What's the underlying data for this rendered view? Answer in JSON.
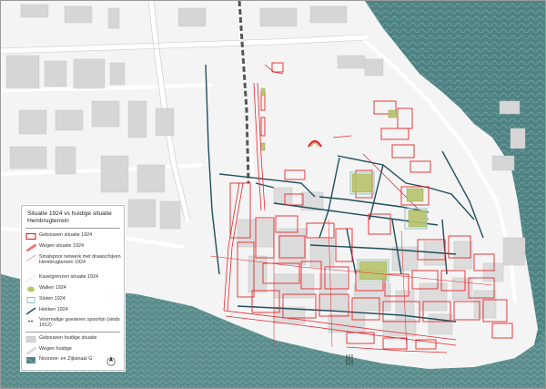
{
  "legend": {
    "title": "Situatie 1924 vs huidige situatie Hembrugterrein",
    "items": [
      {
        "label": "Gebouwen situatie 1924",
        "symbol": "building-1924-icon"
      },
      {
        "label": "Wegen situatie 1924",
        "symbol": "road-1924-icon"
      },
      {
        "label": "Smalspoor netwerk met draaischijven Hembrugterrein 1924",
        "symbol": "narrow-gauge-icon"
      },
      {
        "label": "Kavelgrenzen situatie 1924",
        "symbol": "plot-boundary-icon"
      },
      {
        "label": "Wallen 1924",
        "symbol": "earthwork-icon"
      },
      {
        "label": "Sloten 1924",
        "symbol": "ditch-icon"
      },
      {
        "label": "Hekken 1924",
        "symbol": "fence-icon"
      },
      {
        "label": "Voormalige goederen spoorlijn (sinds 1912)",
        "symbol": "railway-icon"
      },
      {
        "label": "Gebouwen huidige situatie",
        "symbol": "building-current-icon"
      },
      {
        "label": "Wegen huidige",
        "symbol": "road-current-icon"
      },
      {
        "label": "Noorzee- en Zijkanaal G",
        "symbol": "canal-icon"
      }
    ]
  },
  "colors": {
    "water": "#4f8383",
    "land": "#f4f4f4",
    "current_building": "#d6d6d6",
    "building_1924": "#e8262a",
    "wall_1924": "#b7c46a",
    "ditch_1924": "#8fc3c3",
    "fence_1924": "#1f4e5c",
    "railway": "#555555"
  },
  "north_arrow_icon": "north-arrow-icon"
}
